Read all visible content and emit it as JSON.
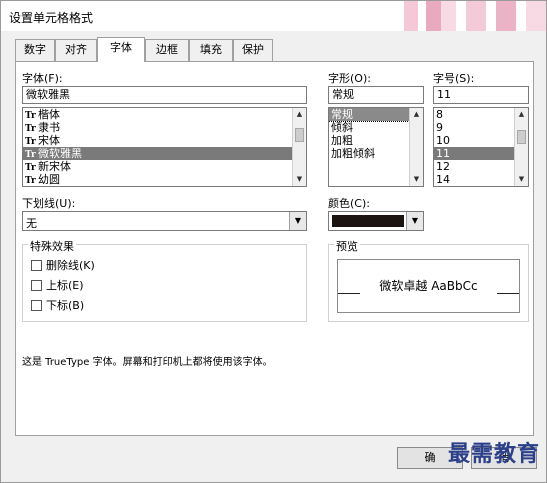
{
  "dialog": {
    "title": "设置单元格格式"
  },
  "tabs": [
    {
      "label": "数字"
    },
    {
      "label": "对齐"
    },
    {
      "label": "字体"
    },
    {
      "label": "边框"
    },
    {
      "label": "填充"
    },
    {
      "label": "保护"
    }
  ],
  "font": {
    "label": "字体(F):",
    "value": "微软雅黑",
    "items": [
      {
        "label": "楷体",
        "icon": "truetype-icon"
      },
      {
        "label": "隶书",
        "icon": "truetype-icon"
      },
      {
        "label": "宋体",
        "icon": "truetype-icon"
      },
      {
        "label": "微软雅黑",
        "icon": "truetype-icon",
        "selected": true
      },
      {
        "label": "新宋体",
        "icon": "truetype-icon"
      },
      {
        "label": "幼圆",
        "icon": "truetype-icon"
      }
    ]
  },
  "style": {
    "label": "字形(O):",
    "value": "常规",
    "items": [
      {
        "label": "常规",
        "selected": true
      },
      {
        "label": "倾斜"
      },
      {
        "label": "加粗"
      },
      {
        "label": "加粗倾斜"
      }
    ]
  },
  "size": {
    "label": "字号(S):",
    "value": "11",
    "items": [
      {
        "label": "8"
      },
      {
        "label": "9"
      },
      {
        "label": "10"
      },
      {
        "label": "11",
        "selected": true
      },
      {
        "label": "12"
      },
      {
        "label": "14"
      }
    ]
  },
  "underline": {
    "label": "下划线(U):",
    "value": "无"
  },
  "color": {
    "label": "颜色(C):",
    "swatch": "#1c1410"
  },
  "effects": {
    "title": "特殊效果",
    "strikethrough": "删除线(K)",
    "superscript": "上标(E)",
    "subscript": "下标(B)"
  },
  "preview": {
    "title": "预览",
    "sample": "微软卓越  AaBbCc"
  },
  "note": "这是 TrueType 字体。屏幕和打印机上都将使用该字体。",
  "buttons": {
    "ok_partial": "确",
    "cancel_partial": "消"
  },
  "watermark": "最需教育"
}
